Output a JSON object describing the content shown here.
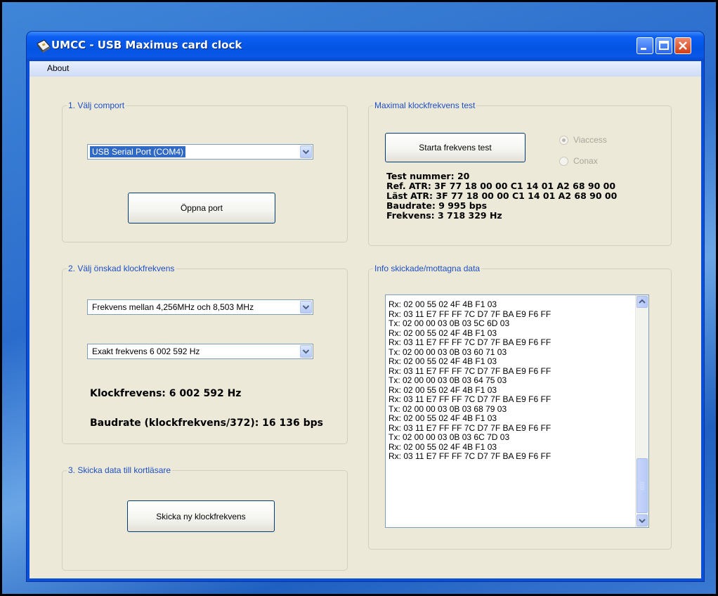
{
  "window": {
    "title": "UMCC - USB Maximus card clock"
  },
  "menu": {
    "about": "About"
  },
  "comport": {
    "legend": "1. Välj comport",
    "selected": "USB Serial Port (COM4)",
    "open_button": "Öppna port"
  },
  "frequency": {
    "legend": "2. Välj önskad klockfrekvens",
    "range_selected": "Frekvens mellan 4,256MHz och 8,503 MHz",
    "exact_selected": "Exakt frekvens  6 002 592 Hz",
    "clock_label": "Klockfrevens:  6 002 592 Hz",
    "baud_label": "Baudrate (klockfrekvens/372):  16 136 bps"
  },
  "send": {
    "legend": "3. Skicka data till kortläsare",
    "button": "Skicka ny klockfrekvens"
  },
  "test": {
    "legend": "Maximal klockfrekvens test",
    "start_button": "Starta frekvens test",
    "radio_viaccess": "Viaccess",
    "radio_conax": "Conax",
    "lines": [
      "Test nummer: 20",
      "Ref.  ATR: 3F 77 18 00 00 C1 14 01 A2 68 90 00",
      "Läst ATR:  3F 77 18 00 00 C1 14 01 A2 68 90 00",
      "Baudrate: 9 995 bps",
      "Frekvens: 3 718 329 Hz"
    ]
  },
  "info": {
    "legend": "Info skickade/mottagna data",
    "lines": [
      "Rx: 02 00 55 02 4F 4B F1 03",
      "Rx: 03 11 E7 FF FF 7C D7 7F BA E9 F6 FF",
      "Tx: 02 00 00 03 0B 03 5C 6D 03",
      "Rx: 02 00 55 02 4F 4B F1 03",
      "Rx: 03 11 E7 FF FF 7C D7 7F BA E9 F6 FF",
      "Tx: 02 00 00 03 0B 03 60 71 03",
      "Rx: 02 00 55 02 4F 4B F1 03",
      "Rx: 03 11 E7 FF FF 7C D7 7F BA E9 F6 FF",
      "Tx: 02 00 00 03 0B 03 64 75 03",
      "Rx: 02 00 55 02 4F 4B F1 03",
      "Rx: 03 11 E7 FF FF 7C D7 7F BA E9 F6 FF",
      "Tx: 02 00 00 03 0B 03 68 79 03",
      "Rx: 02 00 55 02 4F 4B F1 03",
      "Rx: 03 11 E7 FF FF 7C D7 7F BA E9 F6 FF",
      "Tx: 02 00 00 03 0B 03 6C 7D 03",
      "Rx: 02 00 55 02 4F 4B F1 03",
      "Rx: 03 11 E7 FF FF 7C D7 7F BA E9 F6 FF"
    ]
  },
  "colors": {
    "titlebar": "#0454e3",
    "client": "#ece9d8",
    "legend_text": "#1d4fc4",
    "selection": "#316ac5"
  }
}
